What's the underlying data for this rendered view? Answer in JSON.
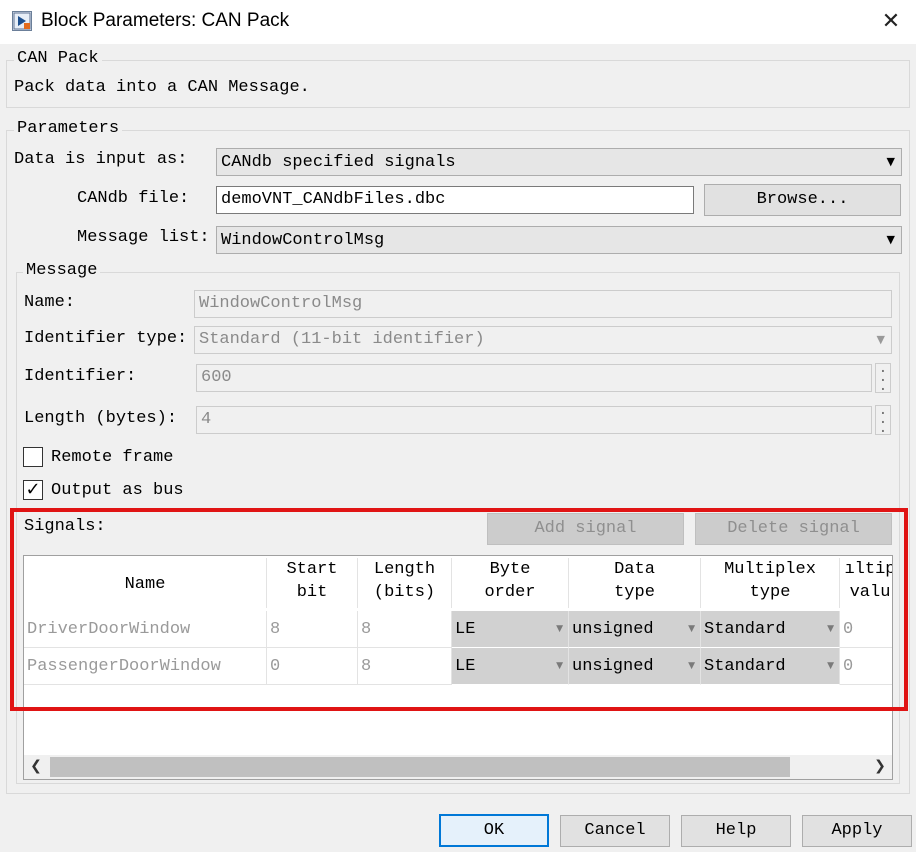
{
  "window": {
    "title": "Block Parameters: CAN Pack",
    "close_glyph": "✕"
  },
  "description": {
    "group_label": "CAN Pack",
    "text": "Pack data into a CAN Message."
  },
  "parameters": {
    "group_label": "Parameters",
    "data_input_label": "Data is input as:",
    "data_input_value": "CANdb specified signals",
    "candb_file_label": "CANdb file:",
    "candb_file_value": "demoVNT_CANdbFiles.dbc",
    "browse_label": "Browse...",
    "message_list_label": "Message list:",
    "message_list_value": "WindowControlMsg"
  },
  "message": {
    "group_label": "Message",
    "name_label": "Name:",
    "name_value": "WindowControlMsg",
    "identifier_type_label": "Identifier type:",
    "identifier_type_value": "Standard (11-bit identifier)",
    "identifier_label": "Identifier:",
    "identifier_value": "600",
    "length_label": "Length (bytes):",
    "length_value": "4",
    "remote_frame_label": "Remote frame",
    "remote_frame_checked": false,
    "output_bus_label": "Output as bus",
    "output_bus_checked": true
  },
  "signals": {
    "label": "Signals:",
    "add_label": "Add signal",
    "delete_label": "Delete signal",
    "columns": [
      {
        "line1": "Name",
        "line2": ""
      },
      {
        "line1": "Start",
        "line2": "bit"
      },
      {
        "line1": "Length",
        "line2": "(bits)"
      },
      {
        "line1": "Byte",
        "line2": "order"
      },
      {
        "line1": "Data",
        "line2": "type"
      },
      {
        "line1": "Multiplex",
        "line2": "type"
      },
      {
        "line1": "ıltip",
        "line2": "valu"
      }
    ],
    "rows": [
      {
        "name": "DriverDoorWindow",
        "start_bit": "8",
        "length": "8",
        "byte_order": "LE",
        "data_type": "unsigned",
        "multiplex_type": "Standard",
        "multiplex_value": "0"
      },
      {
        "name": "PassengerDoorWindow",
        "start_bit": "0",
        "length": "8",
        "byte_order": "LE",
        "data_type": "unsigned",
        "multiplex_type": "Standard",
        "multiplex_value": "0"
      }
    ]
  },
  "footer": {
    "ok_label": "OK",
    "cancel_label": "Cancel",
    "help_label": "Help",
    "apply_label": "Apply"
  },
  "colors": {
    "highlight": "#e01414",
    "focus_border": "#0078d7"
  },
  "icons": [
    "simulink-block-icon",
    "close-icon",
    "dropdown-arrow-icon",
    "spinner-icon",
    "checkmark-icon",
    "scroll-left-icon",
    "scroll-right-icon"
  ]
}
